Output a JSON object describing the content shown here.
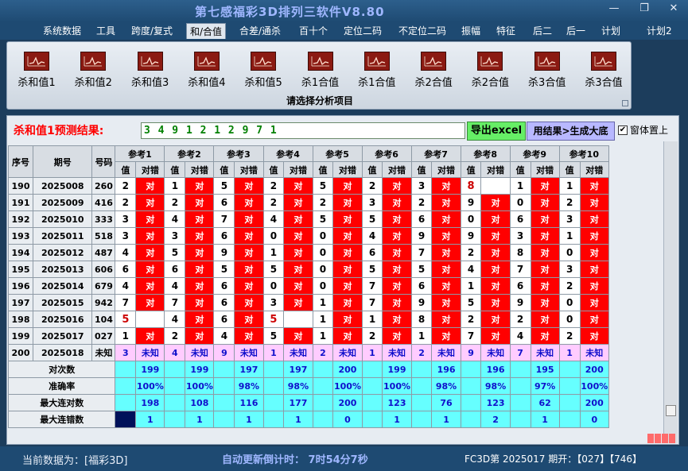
{
  "window": {
    "title": "第七感福彩3D排列三软件V8.80",
    "minimize": "—",
    "restore": "❐",
    "close": "✕"
  },
  "menu": [
    {
      "label": "系统数据",
      "active": false
    },
    {
      "label": "工具",
      "active": false
    },
    {
      "label": "跨度/复式",
      "active": false
    },
    {
      "label": "和/合值",
      "active": true
    },
    {
      "label": "合差/通杀",
      "active": false
    },
    {
      "label": "百十个",
      "active": false
    },
    {
      "label": "定位二码",
      "active": false
    },
    {
      "label": "不定位二码",
      "active": false
    },
    {
      "label": "振幅",
      "active": false
    },
    {
      "label": "特征",
      "active": false
    },
    {
      "label": "后二",
      "active": false
    },
    {
      "label": "后一",
      "active": false
    },
    {
      "label": "计划",
      "active": false
    },
    {
      "label": "计划2",
      "active": false
    }
  ],
  "ribbon": {
    "buttons": [
      "杀和值1",
      "杀和值2",
      "杀和值3",
      "杀和值4",
      "杀和值5",
      "杀1合值",
      "杀1合值",
      "杀2合值",
      "杀2合值",
      "杀3合值",
      "杀3合值"
    ],
    "group_label": "请选择分析项目"
  },
  "prediction": {
    "label": "杀和值1预测结果:",
    "value": "3 4 9 1 2 1 2 9 7 1",
    "export_button": "导出excel",
    "generate_button": "用结果>生成大底",
    "checkbox_label": "窗体置上",
    "checkbox_checked": true
  },
  "table": {
    "col_headers": {
      "seq": "序号",
      "period": "期号",
      "number": "号码"
    },
    "groups": [
      "参考1",
      "参考2",
      "参考3",
      "参考4",
      "参考5",
      "参考6",
      "参考7",
      "参考8",
      "参考9",
      "参考10"
    ],
    "sub_headers": {
      "value": "值",
      "result": "对错"
    },
    "rows": [
      {
        "seq": "190",
        "period": "2025008",
        "number": "260",
        "vals": [
          "2",
          "1",
          "5",
          "2",
          "5",
          "2",
          "3",
          "8",
          "1",
          "1"
        ],
        "results": [
          "对",
          "对",
          "对",
          "对",
          "对",
          "对",
          "对",
          "",
          "对",
          "对"
        ]
      },
      {
        "seq": "191",
        "period": "2025009",
        "number": "416",
        "vals": [
          "2",
          "2",
          "6",
          "2",
          "2",
          "3",
          "2",
          "9",
          "0",
          "2"
        ],
        "results": [
          "对",
          "对",
          "对",
          "对",
          "对",
          "对",
          "对",
          "对",
          "对",
          "对"
        ]
      },
      {
        "seq": "192",
        "period": "2025010",
        "number": "333",
        "vals": [
          "3",
          "4",
          "7",
          "4",
          "5",
          "5",
          "6",
          "0",
          "6",
          "3"
        ],
        "results": [
          "对",
          "对",
          "对",
          "对",
          "对",
          "对",
          "对",
          "对",
          "对",
          "对"
        ]
      },
      {
        "seq": "193",
        "period": "2025011",
        "number": "518",
        "vals": [
          "3",
          "3",
          "6",
          "0",
          "0",
          "4",
          "9",
          "9",
          "3",
          "1"
        ],
        "results": [
          "对",
          "对",
          "对",
          "对",
          "对",
          "对",
          "对",
          "对",
          "对",
          "对"
        ]
      },
      {
        "seq": "194",
        "period": "2025012",
        "number": "487",
        "vals": [
          "4",
          "5",
          "9",
          "1",
          "0",
          "6",
          "7",
          "2",
          "8",
          "0"
        ],
        "results": [
          "对",
          "对",
          "对",
          "对",
          "对",
          "对",
          "对",
          "对",
          "对",
          "对"
        ]
      },
      {
        "seq": "195",
        "period": "2025013",
        "number": "606",
        "vals": [
          "6",
          "6",
          "5",
          "5",
          "0",
          "5",
          "5",
          "4",
          "7",
          "3"
        ],
        "results": [
          "对",
          "对",
          "对",
          "对",
          "对",
          "对",
          "对",
          "对",
          "对",
          "对"
        ]
      },
      {
        "seq": "196",
        "period": "2025014",
        "number": "679",
        "vals": [
          "4",
          "4",
          "6",
          "0",
          "0",
          "7",
          "6",
          "1",
          "6",
          "2"
        ],
        "results": [
          "对",
          "对",
          "对",
          "对",
          "对",
          "对",
          "对",
          "对",
          "对",
          "对"
        ]
      },
      {
        "seq": "197",
        "period": "2025015",
        "number": "942",
        "vals": [
          "7",
          "7",
          "6",
          "3",
          "1",
          "7",
          "9",
          "5",
          "9",
          "0"
        ],
        "results": [
          "对",
          "对",
          "对",
          "对",
          "对",
          "对",
          "对",
          "对",
          "对",
          "对"
        ]
      },
      {
        "seq": "198",
        "period": "2025016",
        "number": "104",
        "vals": [
          "5",
          "4",
          "6",
          "5",
          "1",
          "1",
          "8",
          "2",
          "2",
          "0"
        ],
        "results": [
          "",
          "对",
          "对",
          "",
          "对",
          "对",
          "对",
          "对",
          "对",
          "对"
        ]
      },
      {
        "seq": "199",
        "period": "2025017",
        "number": "027",
        "vals": [
          "1",
          "2",
          "4",
          "5",
          "1",
          "2",
          "1",
          "7",
          "4",
          "2"
        ],
        "results": [
          "对",
          "对",
          "对",
          "对",
          "对",
          "对",
          "对",
          "对",
          "对",
          "对"
        ]
      }
    ],
    "unknown_row": {
      "seq": "200",
      "period": "2025018",
      "number": "未知",
      "vals": [
        "3",
        "4",
        "9",
        "1",
        "2",
        "1",
        "2",
        "9",
        "7",
        "1"
      ],
      "result": "未知"
    },
    "stats": [
      {
        "label": "对次数",
        "values": [
          "199",
          "199",
          "197",
          "197",
          "200",
          "199",
          "196",
          "196",
          "195",
          "200"
        ]
      },
      {
        "label": "准确率",
        "values": [
          "100%",
          "100%",
          "98%",
          "98%",
          "100%",
          "100%",
          "98%",
          "98%",
          "97%",
          "100%"
        ]
      },
      {
        "label": "最大连对数",
        "values": [
          "198",
          "108",
          "116",
          "177",
          "200",
          "123",
          "76",
          "123",
          "62",
          "200"
        ]
      },
      {
        "label": "最大连错数",
        "values": [
          "1",
          "1",
          "1",
          "1",
          "0",
          "1",
          "1",
          "2",
          "1",
          "0"
        ]
      }
    ]
  },
  "status": {
    "current_data": "当前数据为：[福彩3D]",
    "countdown": "自动更新倒计时：  7时54分7秒",
    "period_info": "FC3D第 2025017 期开：【027】【746】"
  }
}
